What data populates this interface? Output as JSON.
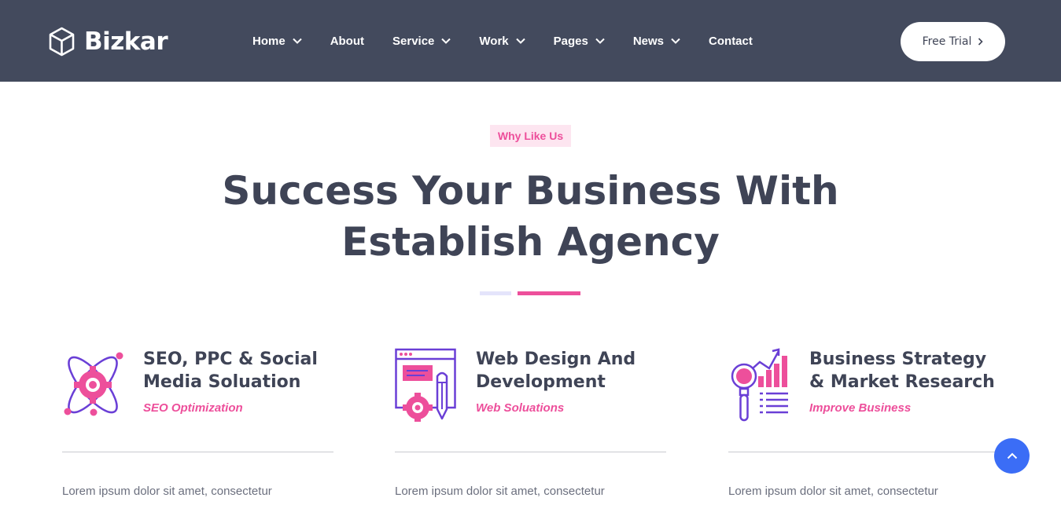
{
  "brand": {
    "name": "Bizkar",
    "icon": "cube-icon"
  },
  "nav": [
    {
      "label": "Home",
      "has_dropdown": true
    },
    {
      "label": "About",
      "has_dropdown": false
    },
    {
      "label": "Service",
      "has_dropdown": true
    },
    {
      "label": "Work",
      "has_dropdown": true
    },
    {
      "label": "Pages",
      "has_dropdown": true
    },
    {
      "label": "News",
      "has_dropdown": true
    },
    {
      "label": "Contact",
      "has_dropdown": false
    }
  ],
  "header": {
    "cta_label": "Free Trial",
    "cta_icon": "chevron-right-icon"
  },
  "section": {
    "badge": "Why Like Us",
    "title_line1": "Success Your Business With",
    "title_line2": "Establish Agency"
  },
  "cards": [
    {
      "icon": "atom-gear-icon",
      "title": "SEO, PPC & Social Media Soluation",
      "subtitle": "SEO Optimization",
      "description": "Lorem ipsum dolor sit amet, consectetur"
    },
    {
      "icon": "web-design-icon",
      "title": "Web Design And Development",
      "subtitle": "Web Soluations",
      "description": "Lorem ipsum dolor sit amet, consectetur"
    },
    {
      "icon": "business-research-icon",
      "title": "Business Strategy & Market Research",
      "subtitle": "Improve Business",
      "description": "Lorem ipsum dolor sit amet, consectetur"
    }
  ],
  "scroll_top": {
    "icon": "chevron-up-icon"
  },
  "colors": {
    "header_bg": "#434a5d",
    "accent_pink": "#ed4f9b",
    "accent_purple": "#6a3fd6",
    "heading": "#3f4456",
    "scroll_button": "#3b6df6"
  }
}
